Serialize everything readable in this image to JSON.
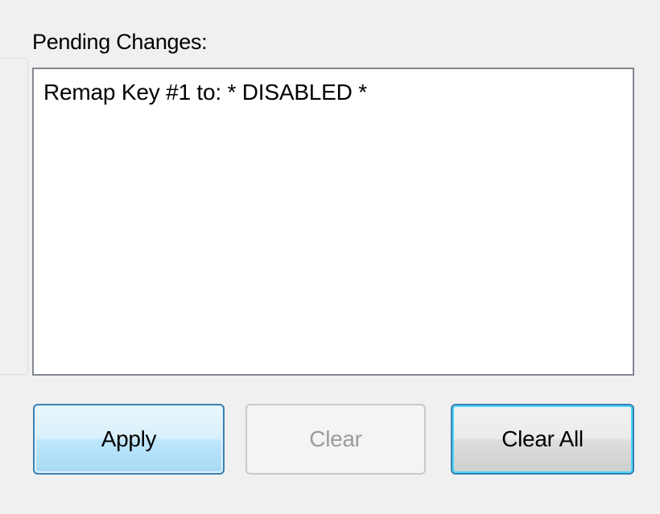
{
  "pending_changes": {
    "label": "Pending Changes:",
    "items": [
      {
        "text": "Remap Key #1 to: * DISABLED *"
      }
    ]
  },
  "buttons": {
    "apply": {
      "label": "Apply",
      "enabled": true
    },
    "clear": {
      "label": "Clear",
      "enabled": false
    },
    "clear_all": {
      "label": "Clear All",
      "enabled": true,
      "focused": true
    }
  },
  "colors": {
    "window_background": "#f0f0f0",
    "list_border": "#828790",
    "button_border_active": "#3c7fb1",
    "button_focus_glow": "#48d8f8",
    "disabled_text": "#9c9c9c"
  }
}
